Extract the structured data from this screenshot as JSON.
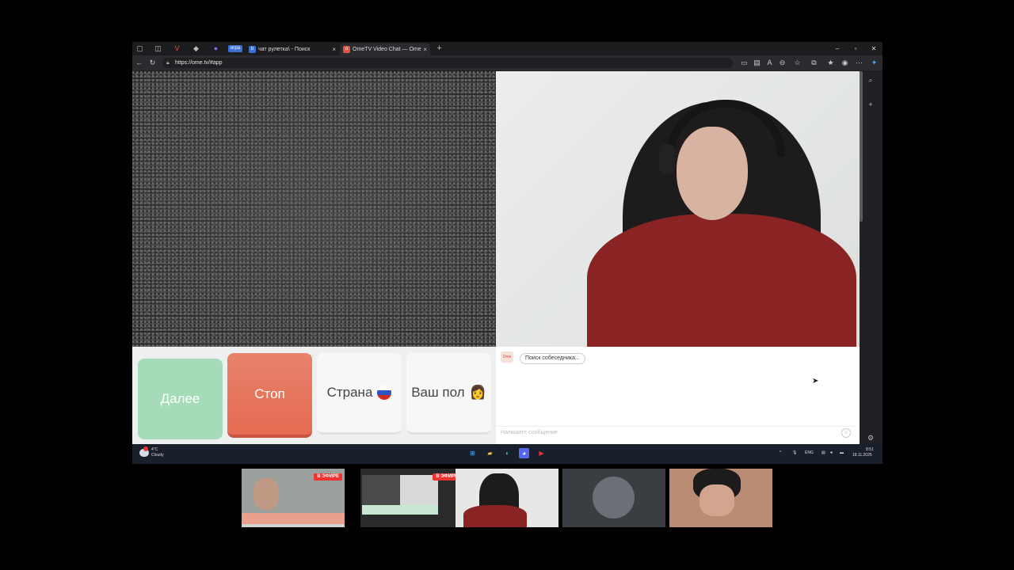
{
  "browser": {
    "tabs": [
      {
        "label": "чат рулетка\\ - Поиск",
        "active": false
      },
      {
        "label": "OmeTV Video Chat — Ome",
        "active": true
      }
    ],
    "game_badge": "игра",
    "url": "https://ome.tv/#app",
    "new_tab": "+"
  },
  "controls": {
    "next_label": "Далее",
    "stop_label": "Стоп",
    "country_label": "Страна",
    "gender_label": "Ваш пол"
  },
  "chat": {
    "status": "Поиск собеседника...",
    "placeholder": "Напишите сообщение"
  },
  "taskbar": {
    "temperature": "4°C",
    "condition": "Cloudy",
    "language": "ENG",
    "time": "8:51",
    "date": "18.11.2025"
  },
  "stream_thumbs": [
    {
      "live_label": "В ЭФИРЕ"
    },
    {
      "live_label": "В ЭФИРЕ"
    }
  ],
  "colors": {
    "next_button": "#a5dbb8",
    "stop_button": "#e56b52",
    "live_badge": "#e33333"
  }
}
